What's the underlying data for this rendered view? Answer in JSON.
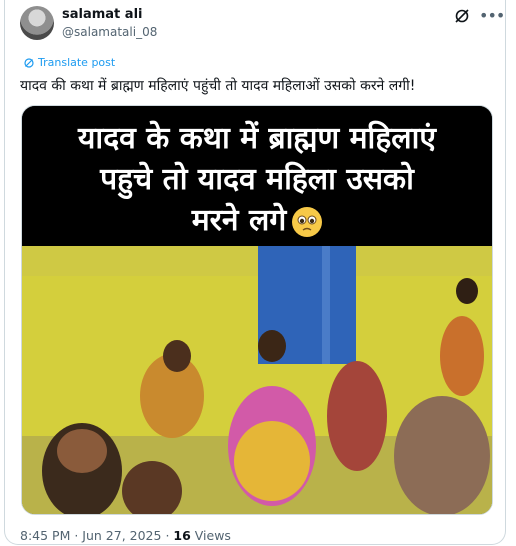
{
  "author": {
    "name": "salamat ali",
    "handle": "@salamatali_08"
  },
  "translate_label": "Translate post",
  "post_text": "यादव की कथा में ब्राह्मण महिलाएं पहुंची तो यादव महिलाओं उसको करने लगी!",
  "media": {
    "caption_line1": "यादव के कथा में  ब्राह्मण महिलाएं",
    "caption_line2": "पहुचे तो  यादव महिला उसको",
    "caption_line3": "मरने लगे"
  },
  "meta": {
    "time": "8:45 PM",
    "separator": " · ",
    "date": "Jun 27, 2025",
    "views_count": "16",
    "views_label": " Views"
  },
  "icons": {
    "grok": "grok-icon",
    "more": "more-icon",
    "translate": "globe-icon",
    "emoji": "pleading-face-emoji"
  },
  "colors": {
    "link": "#1d9bf0",
    "secondary_text": "#536471",
    "border": "#cfd9de"
  }
}
